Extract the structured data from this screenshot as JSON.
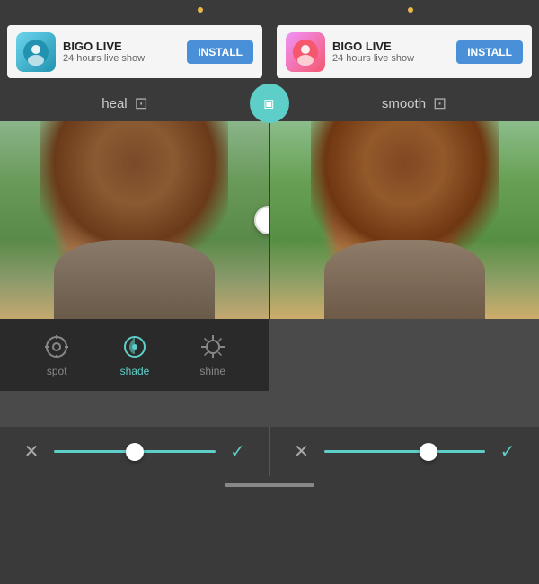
{
  "ads": {
    "left": {
      "title": "BIGO LIVE",
      "subtitle": "24 hours live show",
      "install_label": "INSTALL",
      "emoji": "👤"
    },
    "right": {
      "title": "BIGO LIVE",
      "subtitle": "24 hours live show",
      "install_label": "INSTALL",
      "emoji": "👤"
    }
  },
  "toolbar": {
    "left_label": "heal",
    "right_label": "smooth",
    "swap_title": "swap"
  },
  "tools": {
    "spot": {
      "label": "spot",
      "active": false
    },
    "shade": {
      "label": "shade",
      "active": true
    },
    "shine": {
      "label": "shine",
      "active": false
    }
  },
  "actions": {
    "cancel_left": "✕",
    "confirm_left": "✓",
    "cancel_right": "✕",
    "confirm_right": "✓"
  },
  "colors": {
    "accent": "#5ecec8",
    "dark_bg": "#2a2a2a",
    "mid_bg": "#3a3a3a",
    "text_light": "#cccccc"
  }
}
